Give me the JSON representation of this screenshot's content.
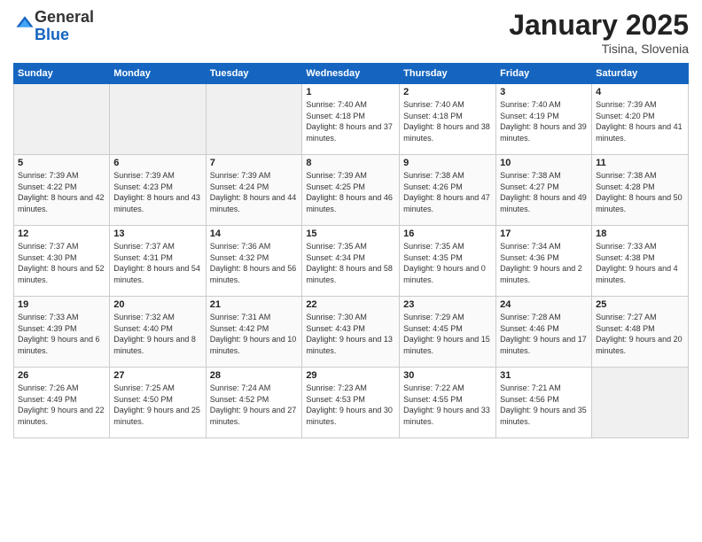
{
  "header": {
    "logo_line1": "General",
    "logo_line2": "Blue",
    "month_title": "January 2025",
    "location": "Tisina, Slovenia"
  },
  "weekdays": [
    "Sunday",
    "Monday",
    "Tuesday",
    "Wednesday",
    "Thursday",
    "Friday",
    "Saturday"
  ],
  "weeks": [
    [
      {
        "day": "",
        "info": ""
      },
      {
        "day": "",
        "info": ""
      },
      {
        "day": "",
        "info": ""
      },
      {
        "day": "1",
        "info": "Sunrise: 7:40 AM\nSunset: 4:18 PM\nDaylight: 8 hours and 37 minutes."
      },
      {
        "day": "2",
        "info": "Sunrise: 7:40 AM\nSunset: 4:18 PM\nDaylight: 8 hours and 38 minutes."
      },
      {
        "day": "3",
        "info": "Sunrise: 7:40 AM\nSunset: 4:19 PM\nDaylight: 8 hours and 39 minutes."
      },
      {
        "day": "4",
        "info": "Sunrise: 7:39 AM\nSunset: 4:20 PM\nDaylight: 8 hours and 41 minutes."
      }
    ],
    [
      {
        "day": "5",
        "info": "Sunrise: 7:39 AM\nSunset: 4:22 PM\nDaylight: 8 hours and 42 minutes."
      },
      {
        "day": "6",
        "info": "Sunrise: 7:39 AM\nSunset: 4:23 PM\nDaylight: 8 hours and 43 minutes."
      },
      {
        "day": "7",
        "info": "Sunrise: 7:39 AM\nSunset: 4:24 PM\nDaylight: 8 hours and 44 minutes."
      },
      {
        "day": "8",
        "info": "Sunrise: 7:39 AM\nSunset: 4:25 PM\nDaylight: 8 hours and 46 minutes."
      },
      {
        "day": "9",
        "info": "Sunrise: 7:38 AM\nSunset: 4:26 PM\nDaylight: 8 hours and 47 minutes."
      },
      {
        "day": "10",
        "info": "Sunrise: 7:38 AM\nSunset: 4:27 PM\nDaylight: 8 hours and 49 minutes."
      },
      {
        "day": "11",
        "info": "Sunrise: 7:38 AM\nSunset: 4:28 PM\nDaylight: 8 hours and 50 minutes."
      }
    ],
    [
      {
        "day": "12",
        "info": "Sunrise: 7:37 AM\nSunset: 4:30 PM\nDaylight: 8 hours and 52 minutes."
      },
      {
        "day": "13",
        "info": "Sunrise: 7:37 AM\nSunset: 4:31 PM\nDaylight: 8 hours and 54 minutes."
      },
      {
        "day": "14",
        "info": "Sunrise: 7:36 AM\nSunset: 4:32 PM\nDaylight: 8 hours and 56 minutes."
      },
      {
        "day": "15",
        "info": "Sunrise: 7:35 AM\nSunset: 4:34 PM\nDaylight: 8 hours and 58 minutes."
      },
      {
        "day": "16",
        "info": "Sunrise: 7:35 AM\nSunset: 4:35 PM\nDaylight: 9 hours and 0 minutes."
      },
      {
        "day": "17",
        "info": "Sunrise: 7:34 AM\nSunset: 4:36 PM\nDaylight: 9 hours and 2 minutes."
      },
      {
        "day": "18",
        "info": "Sunrise: 7:33 AM\nSunset: 4:38 PM\nDaylight: 9 hours and 4 minutes."
      }
    ],
    [
      {
        "day": "19",
        "info": "Sunrise: 7:33 AM\nSunset: 4:39 PM\nDaylight: 9 hours and 6 minutes."
      },
      {
        "day": "20",
        "info": "Sunrise: 7:32 AM\nSunset: 4:40 PM\nDaylight: 9 hours and 8 minutes."
      },
      {
        "day": "21",
        "info": "Sunrise: 7:31 AM\nSunset: 4:42 PM\nDaylight: 9 hours and 10 minutes."
      },
      {
        "day": "22",
        "info": "Sunrise: 7:30 AM\nSunset: 4:43 PM\nDaylight: 9 hours and 13 minutes."
      },
      {
        "day": "23",
        "info": "Sunrise: 7:29 AM\nSunset: 4:45 PM\nDaylight: 9 hours and 15 minutes."
      },
      {
        "day": "24",
        "info": "Sunrise: 7:28 AM\nSunset: 4:46 PM\nDaylight: 9 hours and 17 minutes."
      },
      {
        "day": "25",
        "info": "Sunrise: 7:27 AM\nSunset: 4:48 PM\nDaylight: 9 hours and 20 minutes."
      }
    ],
    [
      {
        "day": "26",
        "info": "Sunrise: 7:26 AM\nSunset: 4:49 PM\nDaylight: 9 hours and 22 minutes."
      },
      {
        "day": "27",
        "info": "Sunrise: 7:25 AM\nSunset: 4:50 PM\nDaylight: 9 hours and 25 minutes."
      },
      {
        "day": "28",
        "info": "Sunrise: 7:24 AM\nSunset: 4:52 PM\nDaylight: 9 hours and 27 minutes."
      },
      {
        "day": "29",
        "info": "Sunrise: 7:23 AM\nSunset: 4:53 PM\nDaylight: 9 hours and 30 minutes."
      },
      {
        "day": "30",
        "info": "Sunrise: 7:22 AM\nSunset: 4:55 PM\nDaylight: 9 hours and 33 minutes."
      },
      {
        "day": "31",
        "info": "Sunrise: 7:21 AM\nSunset: 4:56 PM\nDaylight: 9 hours and 35 minutes."
      },
      {
        "day": "",
        "info": ""
      }
    ]
  ]
}
